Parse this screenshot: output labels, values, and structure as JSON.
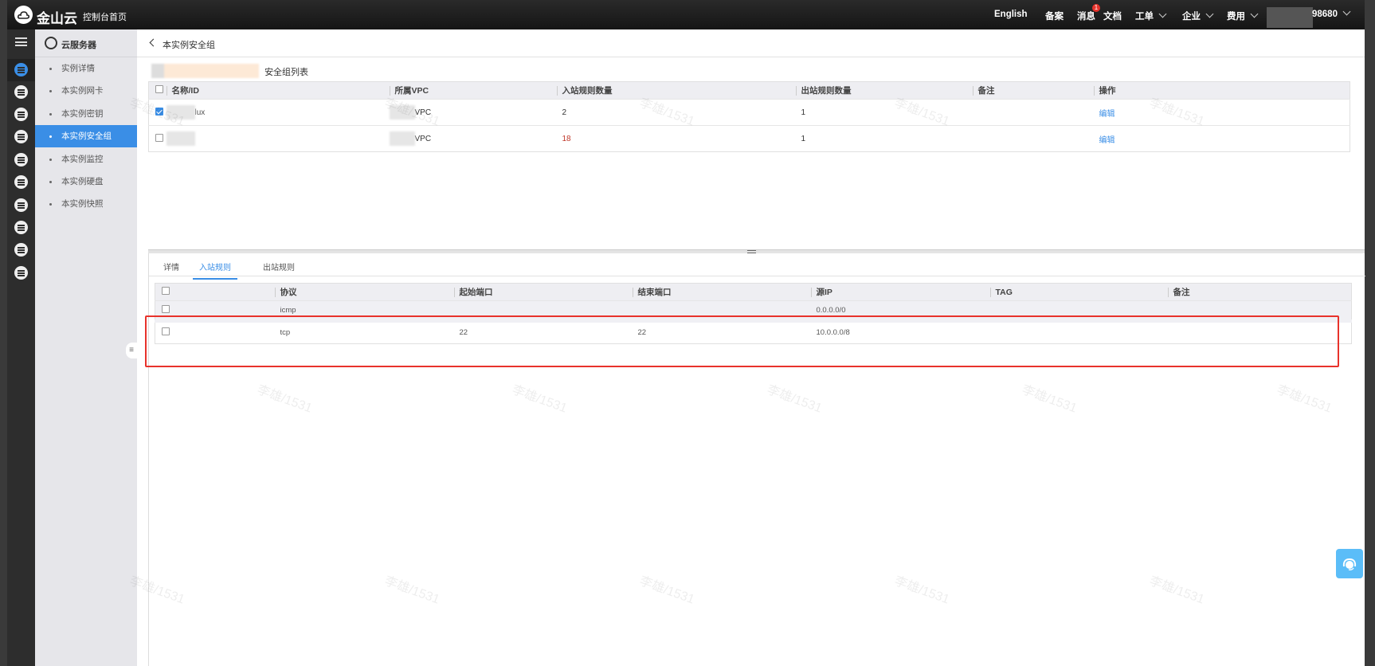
{
  "header": {
    "brand": "金山云",
    "console_home": "控制台首页",
    "nav": [
      "English",
      "备案",
      "消息",
      "文档"
    ],
    "message_badge": "1",
    "dropdowns": [
      "工单",
      "企业",
      "费用"
    ],
    "account_suffix": "98680"
  },
  "sidebar": {
    "title": "云服务器",
    "items": [
      {
        "label": "实例详情"
      },
      {
        "label": "本实例网卡"
      },
      {
        "label": "本实例密钥"
      },
      {
        "label": "本实例安全组",
        "active": true
      },
      {
        "label": "本实例监控"
      },
      {
        "label": "本实例硬盘"
      },
      {
        "label": "本实例快照"
      }
    ]
  },
  "breadcrumb": {
    "title": "本实例安全组"
  },
  "sg_list": {
    "title_suffix": "安全组列表",
    "columns": [
      "名称/ID",
      "所属VPC",
      "入站规则数量",
      "出站规则数量",
      "备注",
      "操作"
    ],
    "rows": [
      {
        "checked": true,
        "name": "lux",
        "vpc": "VPC",
        "inbound": "2",
        "outbound": "1",
        "note": "",
        "action": "编辑"
      },
      {
        "checked": false,
        "name": "",
        "vpc": "VPC",
        "inbound": "18",
        "outbound": "1",
        "note": "",
        "action": "编辑"
      }
    ]
  },
  "tabs": [
    "详情",
    "入站规则",
    "出站规则"
  ],
  "active_tab": "入站规则",
  "rules": {
    "columns": [
      "协议",
      "起始端口",
      "结束端口",
      "源IP",
      "TAG",
      "备注"
    ],
    "rows": [
      {
        "protocol": "icmp",
        "start": "",
        "end": "",
        "source": "0.0.0.0/0",
        "tag": "",
        "note": ""
      },
      {
        "protocol": "tcp",
        "start": "22",
        "end": "22",
        "source": "10.0.0.0/8",
        "tag": "",
        "note": ""
      }
    ]
  },
  "watermark": "李雄/1531",
  "colors": {
    "accent": "#3a8ee6",
    "highlight": "#e8322b"
  }
}
